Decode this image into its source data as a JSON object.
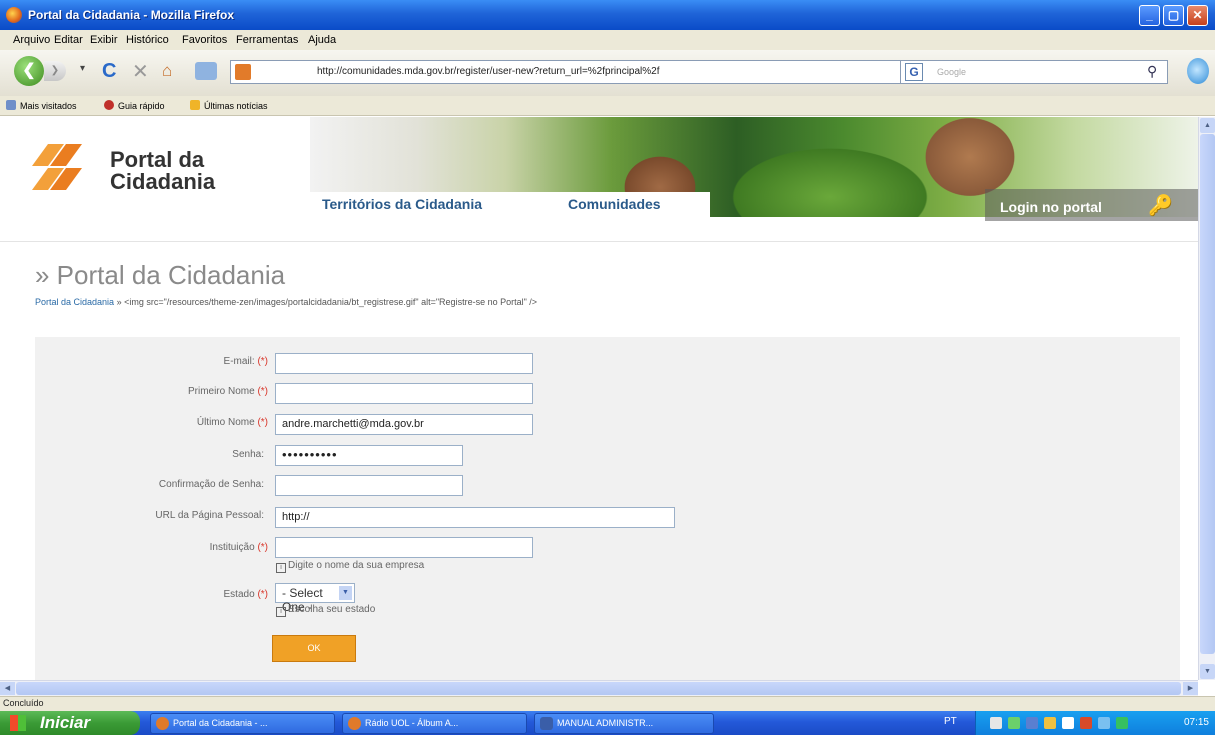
{
  "window": {
    "title": "Portal da Cidadania - Mozilla Firefox"
  },
  "menu": [
    "Arquivo",
    "Editar",
    "Exibir",
    "Histórico",
    "Favoritos",
    "Ferramentas",
    "Ajuda"
  ],
  "nav": {
    "url": "http://comunidades.mda.gov.br/register/user-new?return_url=%2fprincipal%2f",
    "search_placeholder": "Google"
  },
  "bookmarks": [
    "Mais visitados",
    "Guia rápido",
    "Últimas notícias"
  ],
  "header": {
    "logo_line1": "Portal da",
    "logo_line2": "Cidadania",
    "tab_territorios": "Territórios da Cidadania",
    "tab_comunidades": "Comunidades",
    "login": "Login no portal"
  },
  "page": {
    "title": "» Portal da Cidadania",
    "breadcrumb_link": "Portal da Cidadania",
    "breadcrumb_rest": " » <img src=\"/resources/theme-zen/images/portalcidadania/bt_registrese.gif\" alt=\"Registre-se no Portal\" />"
  },
  "form": {
    "email_label": "E-mail:",
    "first_name_label": "Primeiro Nome",
    "last_name_label": "Último Nome",
    "last_name_value": "andre.marchetti@mda.gov.br",
    "password_label": "Senha:",
    "password_value": "••••••••••",
    "confirm_label": "Confirmação de Senha:",
    "url_label": "URL da Página Pessoal:",
    "url_value": "http://",
    "institution_label": "Instituição",
    "institution_hint": "Digite o nome da sua empresa",
    "state_label": "Estado",
    "state_value": "- Select One -",
    "state_hint": "Escolha seu estado",
    "required_mark": "(*)",
    "ok_label": "OK"
  },
  "status": {
    "text": "Concluído"
  },
  "taskbar": {
    "start": "Iniciar",
    "tasks": [
      "Portal da Cidadania - ...",
      "Rádio UOL - Álbum A...",
      "MANUAL ADMINISTR..."
    ],
    "lang": "PT",
    "clock": "07:15"
  }
}
